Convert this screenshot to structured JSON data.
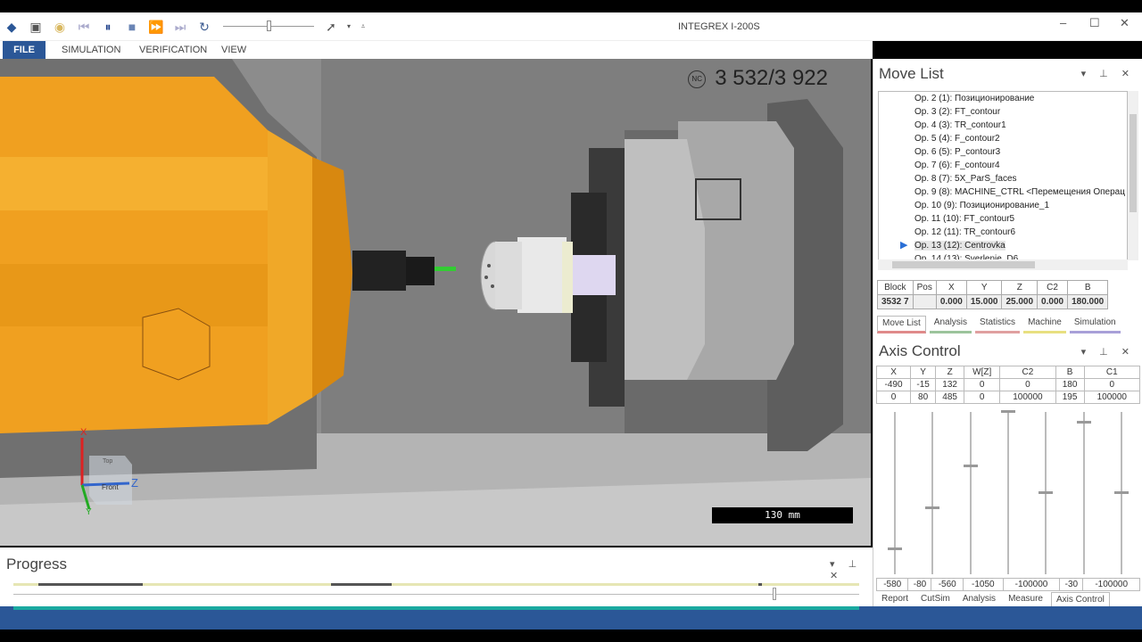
{
  "window": {
    "title": "INTEGREX I-200S"
  },
  "toolbar": {
    "icons": [
      "app-icon",
      "save-icon",
      "open-icon",
      "rewind-icon",
      "pause-icon",
      "stop-icon",
      "step-forward-icon",
      "fast-forward-icon",
      "loop-icon",
      "pointer-icon"
    ],
    "speed_fraction": 0.48
  },
  "menu": [
    "FILE",
    "SIMULATION",
    "VERIFICATION",
    "VIEW"
  ],
  "viewport": {
    "nc_label": "NC",
    "nc_counter": "3 532/3 922",
    "scale_label": "130 mm",
    "triad": {
      "x": "X",
      "z": "Z",
      "y": "Y",
      "top": "Top",
      "front": "Front"
    }
  },
  "move_list": {
    "title": "Move List",
    "items": [
      "Op. 2 (1): Позиционирование",
      "Op. 3 (2): FT_contour",
      "Op. 4 (3): TR_contour1",
      "Op. 5 (4): F_contour2",
      "Op. 6 (5): P_contour3",
      "Op. 7 (6): F_contour4",
      "Op. 8 (7): 5X_ParS_faces",
      "Op. 9 (8): MACHINE_CTRL <Перемещения Операц",
      "Op. 10 (9): Позиционирование_1",
      "Op. 11 (10): FT_contour5",
      "Op. 12 (11): TR_contour6",
      "Op. 13 (12): Centrovka",
      "Op. 14 (13): Sverlenie_D6"
    ],
    "current_index": 11,
    "block_headers": [
      "Block",
      "Pos",
      "X",
      "Y",
      "Z",
      "C2",
      "B"
    ],
    "block_values": [
      "3532 7",
      "",
      "0.000",
      "15.000",
      "25.000",
      "0.000",
      "180.000"
    ],
    "tabs": [
      {
        "label": "Move List",
        "color": "#e08a8a"
      },
      {
        "label": "Analysis",
        "color": "#9cc49c"
      },
      {
        "label": "Statistics",
        "color": "#e0a0a0"
      },
      {
        "label": "Machine",
        "color": "#e8e080"
      },
      {
        "label": "Simulation",
        "color": "#a8a0d8"
      }
    ]
  },
  "axis_control": {
    "title": "Axis Control",
    "axes": [
      "X",
      "Y",
      "Z",
      "W[Z]",
      "C2",
      "B",
      "C1"
    ],
    "current": [
      "-490",
      "-15",
      "132",
      "0",
      "0",
      "180",
      "0"
    ],
    "max": [
      "0",
      "80",
      "485",
      "0",
      "100000",
      "195",
      "100000"
    ],
    "min": [
      "-580",
      "-80",
      "-560",
      "-1050",
      "-100000",
      "-30",
      "-100000"
    ],
    "tabs": [
      {
        "label": "Report",
        "color": "#8aa8d0"
      },
      {
        "label": "CutSim",
        "color": "#e8e070"
      },
      {
        "label": "Analysis",
        "color": "#9cc49c"
      },
      {
        "label": "Measure",
        "color": "#d08a8a"
      },
      {
        "label": "Axis Control",
        "color": "#c0a8c8"
      }
    ]
  },
  "progress": {
    "title": "Progress",
    "position_fraction": 0.9
  },
  "colors": {
    "accent": "#2b5797",
    "machine": "#f0a020",
    "progress_fill": "#1aa9a0"
  }
}
